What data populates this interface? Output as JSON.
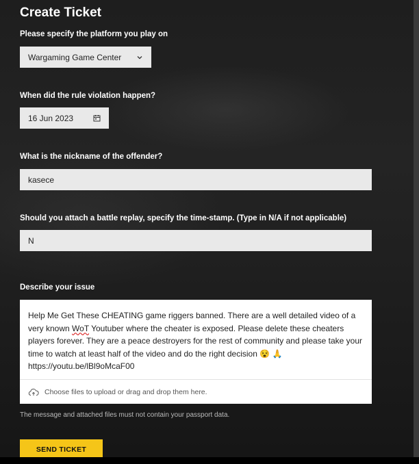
{
  "page_title": "Create Ticket",
  "platform": {
    "label": "Please specify the platform you play on",
    "selected": "Wargaming Game Center"
  },
  "violation_date": {
    "label": "When did the rule violation happen?",
    "value": "16 Jun 2023"
  },
  "offender": {
    "label": "What is the nickname of the offender?",
    "value": "kasece"
  },
  "replay": {
    "label": "Should you attach a battle replay, specify the time-stamp. (Type in N/A if not applicable)",
    "value": "N"
  },
  "issue": {
    "label": "Describe your issue",
    "text_before_misspelled": "Help Me Get These CHEATING game riggers banned. There are a well detailed video of a very known",
    "misspelled_word": "WoT",
    "text_after_misspelled": "Youtuber where the cheater is exposed. Please delete these cheaters players forever. They are a peace destroyers for the rest of community and please take your time to watch at least half of the video and do the right decision 😵 🙏",
    "link": "https://youtu.be/lBl9oMcaF00",
    "attach_label": "Choose files to upload or drag and drop them here."
  },
  "note": "The message and attached files must not contain your passport data.",
  "submit_label": "SEND TICKET",
  "colors": {
    "accent": "#f5c518",
    "input_bg": "#e9e9e9",
    "page_bg": "#1f1f1f"
  },
  "icons": {
    "select": "chevron-down-icon",
    "date": "calendar-icon",
    "attach": "cloud-upload-icon"
  }
}
